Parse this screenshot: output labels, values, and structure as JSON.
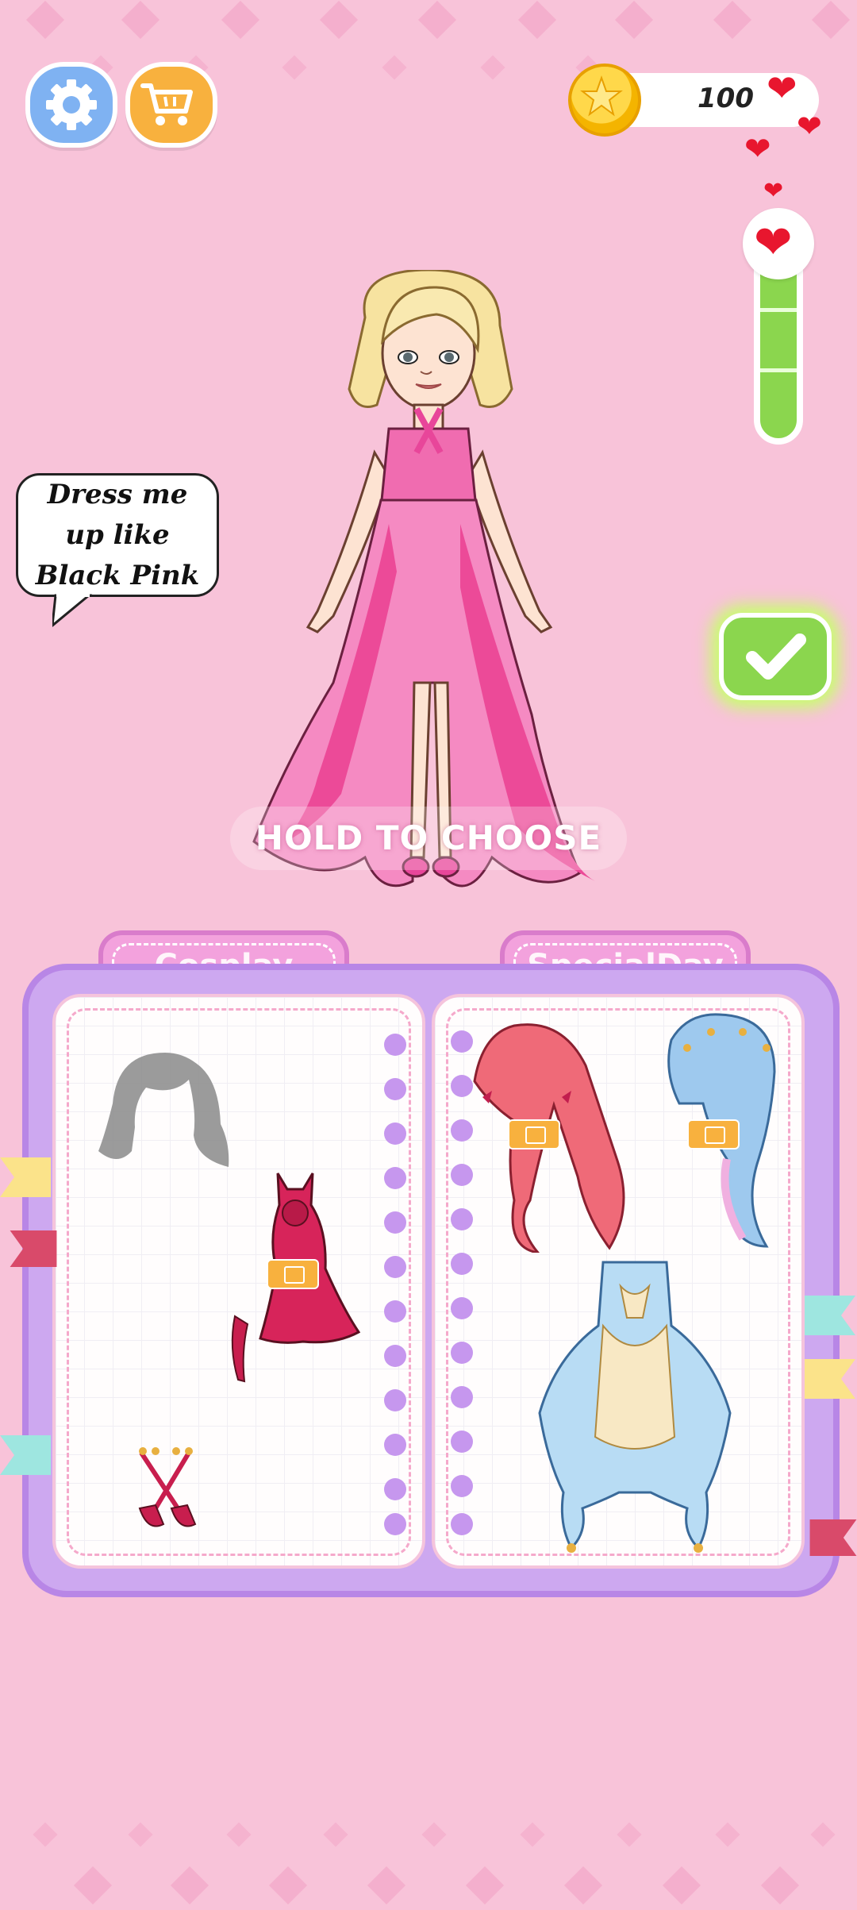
{
  "topbar": {
    "coins": "100",
    "icons": [
      "gear-icon",
      "shopping-cart-icon",
      "star-coin-icon",
      "heart-icon"
    ]
  },
  "request": {
    "text": "Dress me up like Black Pink"
  },
  "character": {
    "hint": "HOLD TO CHOOSE"
  },
  "meter": {
    "fill_fraction": 1.0
  },
  "book": {
    "tabs": [
      {
        "label": "Cosplay"
      },
      {
        "label": "SpecialDay"
      }
    ]
  },
  "colors": {
    "background": "#f8c3d9",
    "accent_pink": "#e8469a",
    "confirm_green": "#8bd64e",
    "ad_badge": "#f8b13e",
    "book_purple": "#cda8f0"
  }
}
